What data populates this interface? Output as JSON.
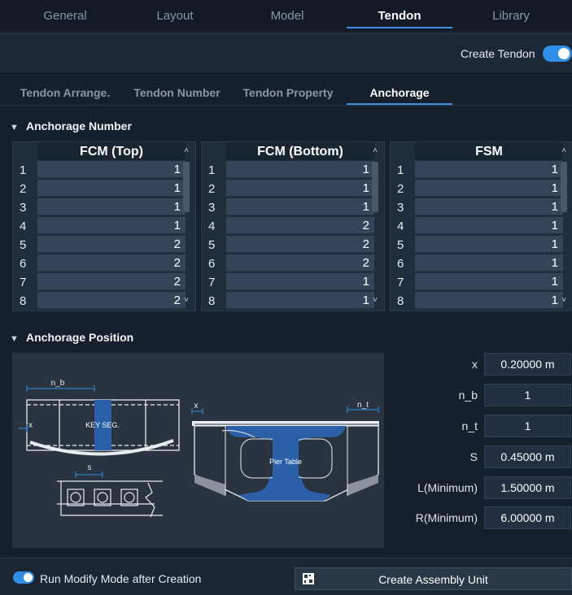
{
  "main_tabs": [
    "General",
    "Layout",
    "Model",
    "Tendon",
    "Library"
  ],
  "active_main_tab": "Tendon",
  "create_tendon": {
    "label": "Create Tendon",
    "enabled": true
  },
  "sub_tabs": [
    "Tendon Arrange.",
    "Tendon Number",
    "Tendon Property",
    "Anchorage"
  ],
  "active_sub_tab": "Anchorage",
  "anchorage_number": {
    "title": "Anchorage Number",
    "tables": [
      {
        "header": "FCM (Top)",
        "rows": [
          {
            "idx": "1",
            "val": "1"
          },
          {
            "idx": "2",
            "val": "1"
          },
          {
            "idx": "3",
            "val": "1"
          },
          {
            "idx": "4",
            "val": "1"
          },
          {
            "idx": "5",
            "val": "2"
          },
          {
            "idx": "6",
            "val": "2"
          },
          {
            "idx": "7",
            "val": "2"
          },
          {
            "idx": "8",
            "val": "2"
          }
        ]
      },
      {
        "header": "FCM (Bottom)",
        "rows": [
          {
            "idx": "1",
            "val": "1"
          },
          {
            "idx": "2",
            "val": "1"
          },
          {
            "idx": "3",
            "val": "1"
          },
          {
            "idx": "4",
            "val": "2"
          },
          {
            "idx": "5",
            "val": "2"
          },
          {
            "idx": "6",
            "val": "2"
          },
          {
            "idx": "7",
            "val": "1"
          },
          {
            "idx": "8",
            "val": "1"
          }
        ]
      },
      {
        "header": "FSM",
        "rows": [
          {
            "idx": "1",
            "val": "1"
          },
          {
            "idx": "2",
            "val": "1"
          },
          {
            "idx": "3",
            "val": "1"
          },
          {
            "idx": "4",
            "val": "1"
          },
          {
            "idx": "5",
            "val": "1"
          },
          {
            "idx": "6",
            "val": "1"
          },
          {
            "idx": "7",
            "val": "1"
          },
          {
            "idx": "8",
            "val": "1"
          }
        ]
      }
    ]
  },
  "anchorage_position": {
    "title": "Anchorage Position",
    "diagram": {
      "n_b": "n_b",
      "key_seg": "KEY SEG.",
      "x": "x",
      "s": "s",
      "n_t": "n_t",
      "pier_table": "Pier Table"
    },
    "params": [
      {
        "label": "x",
        "value": "0.20000 m"
      },
      {
        "label": "n_b",
        "value": "1"
      },
      {
        "label": "n_t",
        "value": "1"
      },
      {
        "label": "S",
        "value": "0.45000 m"
      },
      {
        "label": "L(Minimum)",
        "value": "1.50000 m"
      },
      {
        "label": "R(Minimum)",
        "value": "6.00000 m"
      }
    ]
  },
  "run_modify": {
    "label": "Run Modify Mode after Creation",
    "enabled": true
  },
  "create_assembly": {
    "label": "Create Assembly Unit"
  },
  "colors": {
    "accent": "#2f8ee6",
    "highlight_blue": "#2b5fa8",
    "background": "#16202d"
  }
}
